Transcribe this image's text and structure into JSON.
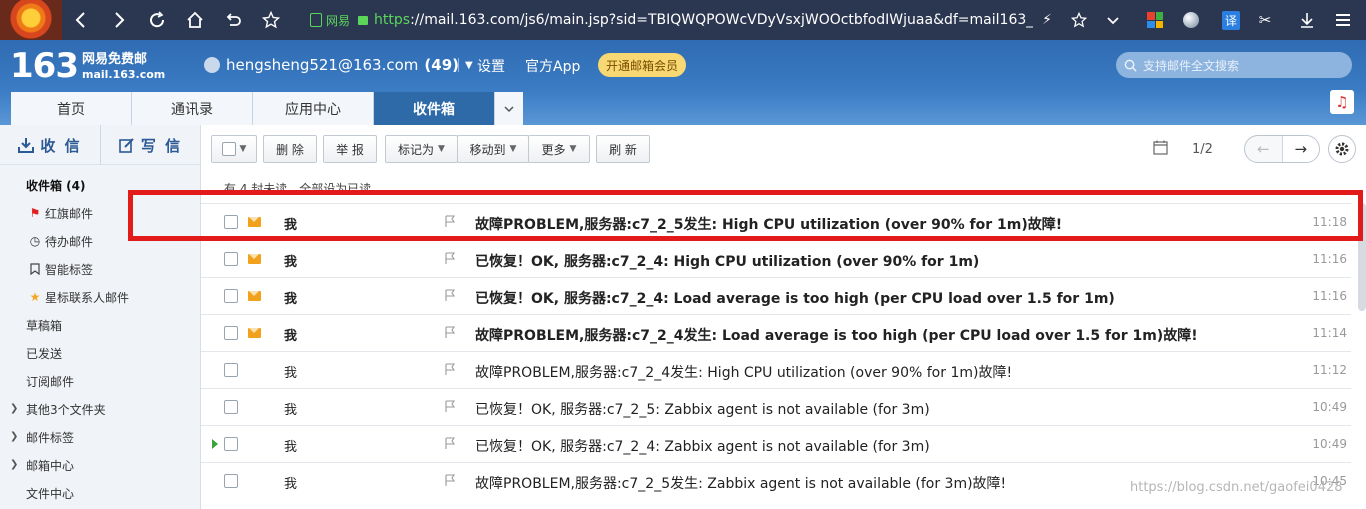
{
  "browser": {
    "security_label": "网易",
    "url_scheme": "https",
    "url_rest": "://mail.163.com/js6/main.jsp?sid=TBIQWQPOWcVDyVsxjWOOctbfodIWjuaa&df=mail163_",
    "translate_label": "译"
  },
  "brand": {
    "logo_number": "163",
    "logo_title": "网易免费邮",
    "logo_domain": "mail.163.com"
  },
  "account": {
    "email": "hengsheng521@163.com",
    "unread_count": "(49)",
    "settings_label": "设置",
    "app_label": "官方App",
    "vip_label": "开通邮箱会员",
    "search_placeholder": "支持邮件全文搜索"
  },
  "tabs": [
    {
      "label": "首页"
    },
    {
      "label": "通讯录"
    },
    {
      "label": "应用中心"
    },
    {
      "label": "收件箱"
    }
  ],
  "sidebar": {
    "receive_label": "收 信",
    "write_label": "写 信",
    "folders": [
      {
        "label": "收件箱 (4)"
      },
      {
        "label": "红旗邮件"
      },
      {
        "label": "待办邮件"
      },
      {
        "label": "智能标签"
      },
      {
        "label": "星标联系人邮件"
      },
      {
        "label": "草稿箱"
      },
      {
        "label": "已发送"
      },
      {
        "label": "订阅邮件"
      },
      {
        "label": "其他3个文件夹"
      },
      {
        "label": "邮件标签"
      },
      {
        "label": "邮箱中心"
      },
      {
        "label": "文件中心"
      }
    ]
  },
  "toolbar": {
    "delete_label": "删 除",
    "report_label": "举 报",
    "mark_label": "标记为",
    "move_label": "移动到",
    "more_label": "更多",
    "refresh_label": "刷 新",
    "page_indicator": "1/2"
  },
  "list": {
    "summary": "有 4 封未读，全部设为已读",
    "emails": [
      {
        "sender": "我",
        "subject": "故障PROBLEM,服务器:c7_2_5发生: High CPU utilization (over 90% for 1m)故障!",
        "time": "11:18",
        "unread": true
      },
      {
        "sender": "我",
        "subject": "已恢复！OK, 服务器:c7_2_4: High CPU utilization (over 90% for 1m)",
        "time": "11:16",
        "unread": true
      },
      {
        "sender": "我",
        "subject": "已恢复！OK, 服务器:c7_2_4: Load average is too high (per CPU load over 1.5 for 1m)",
        "time": "11:16",
        "unread": true
      },
      {
        "sender": "我",
        "subject": "故障PROBLEM,服务器:c7_2_4发生: Load average is too high (per CPU load over 1.5 for 1m)故障!",
        "time": "11:14",
        "unread": true
      },
      {
        "sender": "我",
        "subject": "故障PROBLEM,服务器:c7_2_4发生: High CPU utilization (over 90% for 1m)故障!",
        "time": "11:12",
        "unread": false
      },
      {
        "sender": "我",
        "subject": "已恢复！OK, 服务器:c7_2_5: Zabbix agent is not available (for 3m)",
        "time": "10:49",
        "unread": false
      },
      {
        "sender": "我",
        "subject": "已恢复！OK, 服务器:c7_2_4: Zabbix agent is not available (for 3m)",
        "time": "10:49",
        "unread": false
      },
      {
        "sender": "我",
        "subject": "故障PROBLEM,服务器:c7_2_5发生: Zabbix agent is not available (for 3m)故障!",
        "time": "10:45",
        "unread": false
      }
    ]
  },
  "watermark": "https://blog.csdn.net/gaofei0428",
  "colors": {
    "header_blue": "#2f6bb2",
    "active_tab": "#2f6aa8",
    "highlight_red": "#e31a1a",
    "vip_yellow": "#f7d873"
  }
}
